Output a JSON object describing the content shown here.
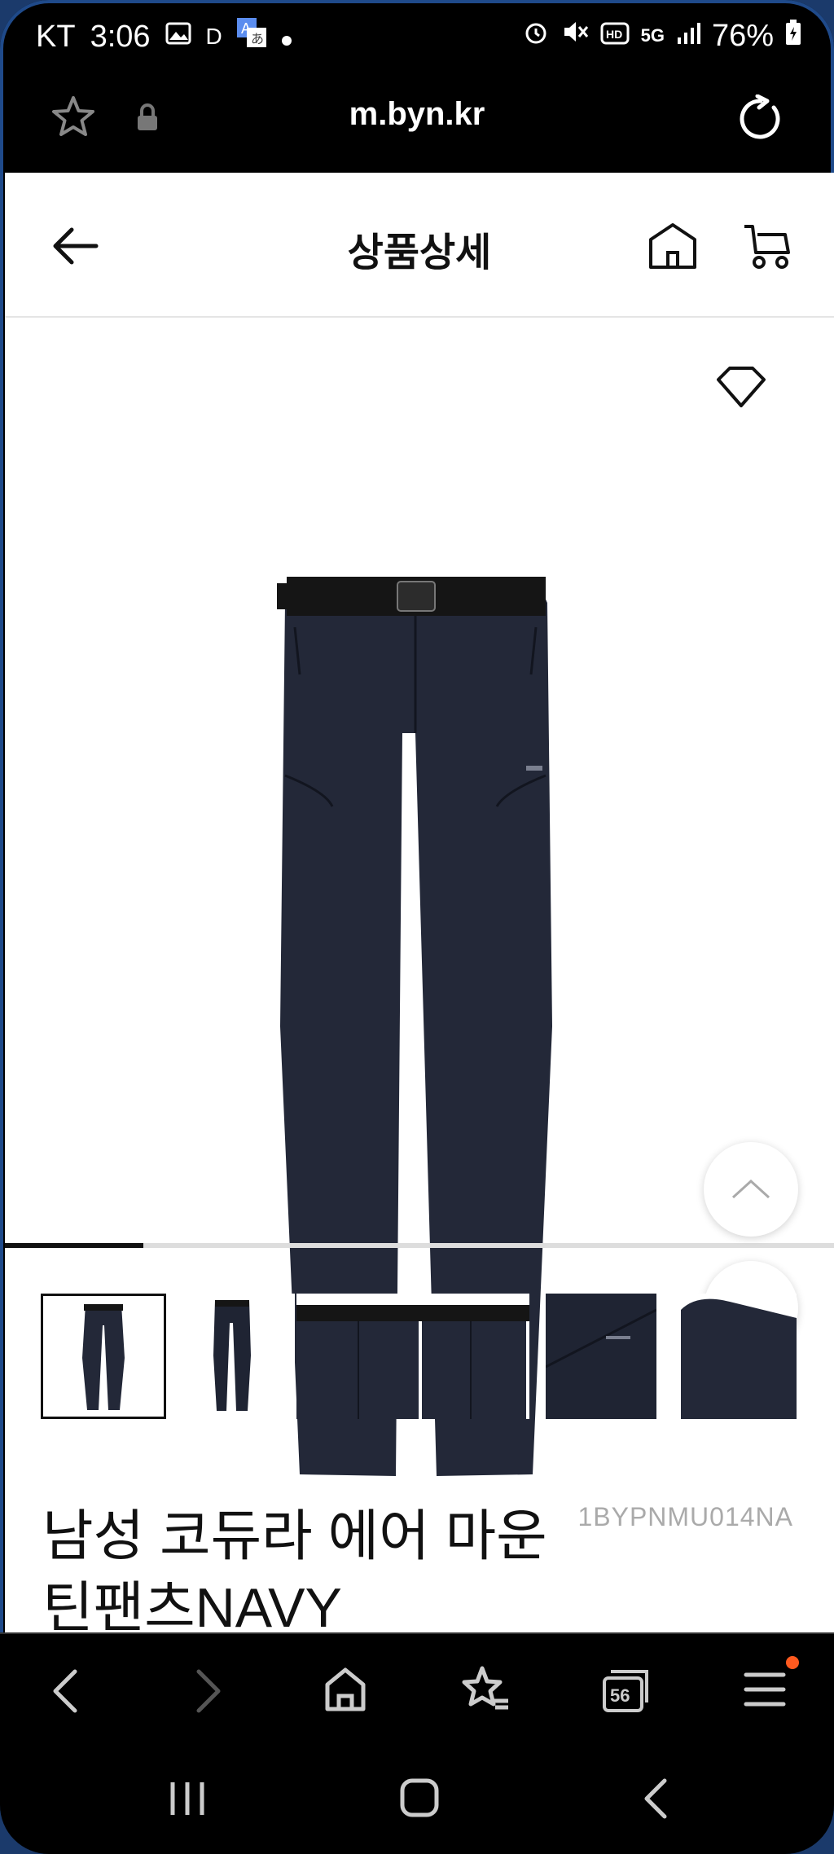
{
  "status_bar": {
    "carrier": "KT",
    "time": "3:06",
    "indicator_d": "D",
    "battery": "76%",
    "network": "5G"
  },
  "browser": {
    "url": "m.byn.kr",
    "tabs_count": "56"
  },
  "page": {
    "title": "상품상세",
    "product": {
      "name": "남성 코듀라 에어 마운틴팬츠NAVY",
      "code": "1BYPNMU014NA",
      "image_colors": {
        "pants": "#232838",
        "belt": "#151515"
      }
    },
    "carousel_progress": 0.167
  },
  "icons": {
    "back": "arrow-left-icon",
    "home": "home-icon",
    "cart": "cart-icon",
    "wishlist": "heart-icon"
  }
}
